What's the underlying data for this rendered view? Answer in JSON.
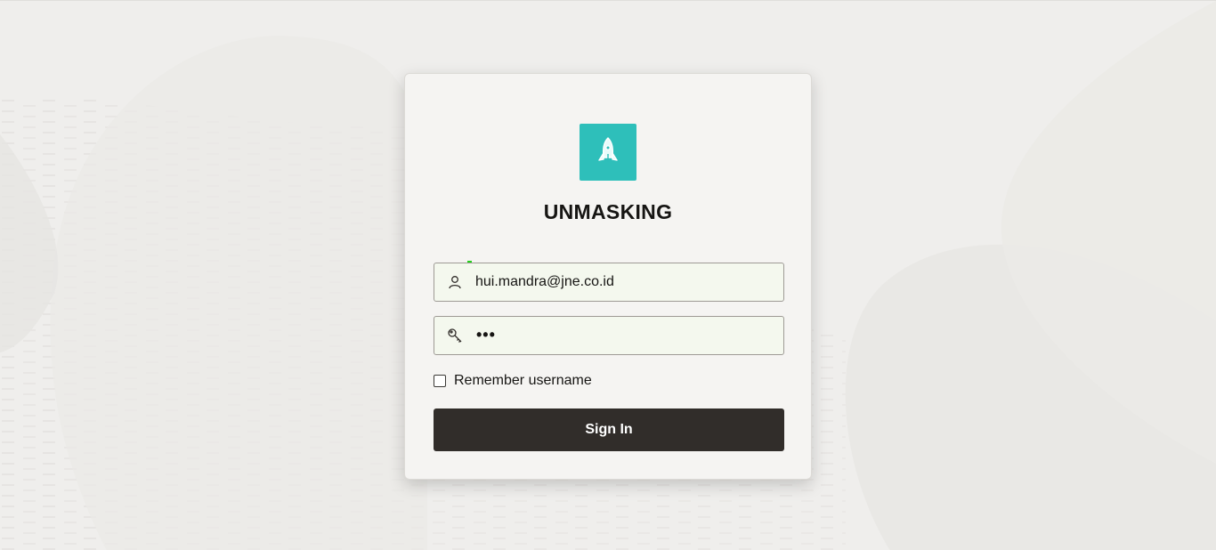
{
  "app": {
    "title": "UNMASKING",
    "logo_icon": "rocket-icon",
    "logo_color": "#2ebfba"
  },
  "login": {
    "username_icon": "user-icon",
    "username_value": "hui.mandra@jne.co.id",
    "password_icon": "key-icon",
    "password_masked": "•••",
    "remember_label": "Remember username",
    "remember_checked": false,
    "signin_label": "Sign In",
    "signin_color": "#312d2a"
  }
}
